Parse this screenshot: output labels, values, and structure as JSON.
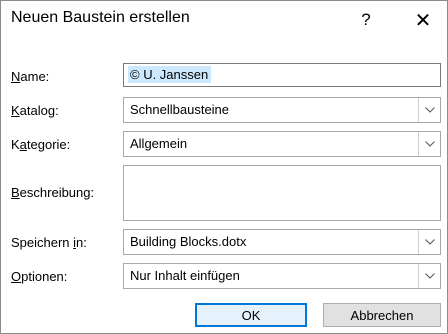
{
  "dialog": {
    "title": "Neuen Baustein erstellen",
    "help_glyph": "?",
    "close_glyph": "✕"
  },
  "fields": {
    "name": {
      "label_pre": "",
      "label_acc": "N",
      "label_post": "ame:",
      "value": "© U. Janssen"
    },
    "katalog": {
      "label_pre": "",
      "label_acc": "K",
      "label_post": "atalog:",
      "value": "Schnellbausteine"
    },
    "kategorie": {
      "label_pre": "K",
      "label_acc": "a",
      "label_post": "tegorie:",
      "value": "Allgemein"
    },
    "beschreibung": {
      "label_pre": "",
      "label_acc": "B",
      "label_post": "eschreibung:",
      "value": ""
    },
    "speichern": {
      "label_pre": "Speichern ",
      "label_acc": "i",
      "label_post": "n:",
      "value": "Building Blocks.dotx"
    },
    "optionen": {
      "label_pre": "",
      "label_acc": "O",
      "label_post": "ptionen:",
      "value": "Nur Inhalt einfügen"
    }
  },
  "buttons": {
    "ok": "OK",
    "cancel": "Abbrechen"
  },
  "colors": {
    "selection": "#cce8ff",
    "default_button_border": "#0078d7"
  }
}
